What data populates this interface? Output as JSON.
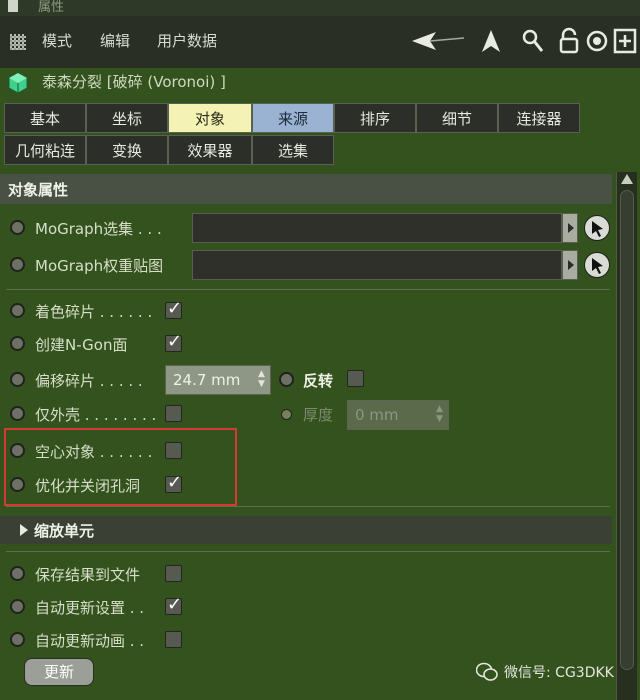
{
  "window": {
    "title": "属性"
  },
  "menu": {
    "items": [
      "模式",
      "编辑",
      "用户数据"
    ]
  },
  "object": {
    "title": "泰森分裂 [破碎 (Voronoi) ]"
  },
  "tabs": {
    "row1": [
      "基本",
      "坐标",
      "对象",
      "来源",
      "排序",
      "细节",
      "连接器"
    ],
    "row2": [
      "几何粘连",
      "变换",
      "效果器",
      "选集"
    ],
    "active": "对象",
    "source_tab": "来源"
  },
  "section": {
    "title": "对象属性"
  },
  "fields": {
    "mograph_selection": {
      "label": "MoGraph选集 . . .",
      "value": ""
    },
    "mograph_weight_map": {
      "label": "MoGraph权重贴图",
      "value": ""
    },
    "color_fragments": {
      "label": "着色碎片 . . . . . .",
      "checked": true
    },
    "create_ngon": {
      "label": "创建N-Gon面",
      "checked": true
    },
    "offset_fragments": {
      "label": "偏移碎片 . . . . .",
      "value": "24.7 mm"
    },
    "invert": {
      "label": "反转",
      "checked": false
    },
    "outer_shell_only": {
      "label": "仅外壳 . . . . . . . .",
      "checked": false
    },
    "thickness": {
      "label": "厚度",
      "value": "0 mm"
    },
    "hollow_object": {
      "label": "空心对象 . . . . . .",
      "checked": false
    },
    "optimize_close_holes": {
      "label": "优化并关闭孔洞",
      "checked": true
    }
  },
  "scale_section": {
    "title": "缩放单元"
  },
  "bottom": {
    "save_to_file": {
      "label": "保存结果到文件",
      "checked": false
    },
    "auto_update_settings": {
      "label": "自动更新设置 . .",
      "checked": true
    },
    "auto_update_animation": {
      "label": "自动更新动画 . .",
      "checked": false
    },
    "update_button": "更新"
  },
  "watermark": "微信号: CG3DKK",
  "colors": {
    "panel_bg": "#34521d",
    "active_tab": "#f4f2b4",
    "source_tab": "#9bb3d3",
    "highlight": "#d53b32"
  }
}
